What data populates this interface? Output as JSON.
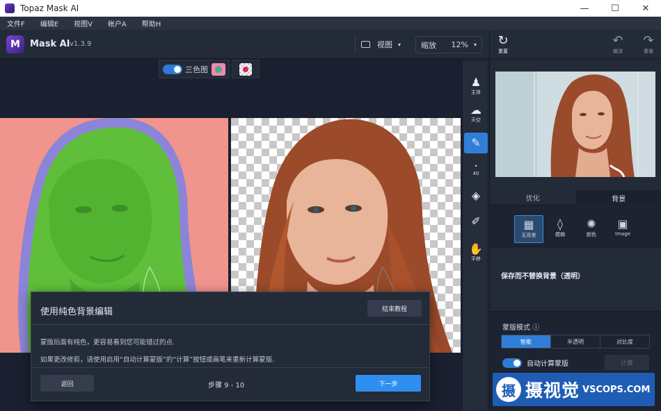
{
  "window": {
    "title": "Topaz Mask AI"
  },
  "menu": [
    "文件F",
    "编辑E",
    "视图V",
    "帐户A",
    "帮助H"
  ],
  "app": {
    "name": "Mask AI",
    "version": "v1.3.9"
  },
  "toolbar": {
    "view_label": "视图",
    "zoom_label": "缩放",
    "zoom_value": "12%"
  },
  "canvas_tools": {
    "tricolor_label": "三色图"
  },
  "side_tools": [
    {
      "icon": "person-icon",
      "label": "主体"
    },
    {
      "icon": "sky-icon",
      "label": "天空"
    },
    {
      "icon": "brush-icon",
      "label": ""
    },
    {
      "icon": "brush-size-icon",
      "label": "40"
    },
    {
      "icon": "fill-bucket-icon",
      "label": ""
    },
    {
      "icon": "eyedropper-icon",
      "label": ""
    },
    {
      "icon": "hand-icon",
      "label": "平移"
    }
  ],
  "right_top": {
    "reset_label": "重置",
    "undo_label": "撤消",
    "redo_label": "重做"
  },
  "tabs": {
    "refine": "优化",
    "background": "背景"
  },
  "bg_options": [
    {
      "icon": "checker-icon",
      "label": "无背景"
    },
    {
      "icon": "drop-icon",
      "label": "模糊"
    },
    {
      "icon": "palette-icon",
      "label": "颜色"
    },
    {
      "icon": "image-icon",
      "label": "Image"
    }
  ],
  "save_text": "保存而不替换背景（透明）",
  "mask_mode": {
    "label": "蒙版模式",
    "options": [
      "智能",
      "半透明",
      "对比度"
    ]
  },
  "auto_compute": {
    "label": "自动计算蒙版",
    "calc_label": "计算"
  },
  "dialog": {
    "title": "使用纯色背景编辑",
    "end_label": "结束教程",
    "line1": "蒙版后面有纯色，更容易看到您可能错过的点.",
    "line2": "如果更改修剪，请使用启用“自动计算蒙版”的“计算”按钮或画笔来重新计算蒙版.",
    "back_label": "返回",
    "steps_label": "步骤 9 - 10",
    "next_label": "下一步"
  },
  "watermark": {
    "cn": "摄视觉",
    "en": "VSCOPS.COM",
    "logo_char": "摄"
  }
}
